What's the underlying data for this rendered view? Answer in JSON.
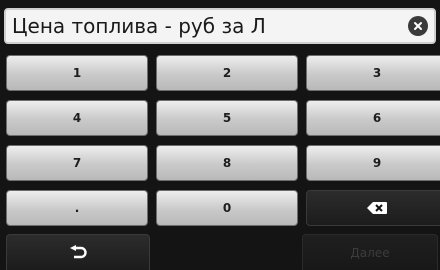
{
  "input": {
    "value": "Цена топлива - руб за Л",
    "clear_icon": "clear-circle-icon"
  },
  "keypad": {
    "keys": [
      {
        "label": "1",
        "name": "key-1"
      },
      {
        "label": "2",
        "name": "key-2"
      },
      {
        "label": "3",
        "name": "key-3"
      },
      {
        "label": "4",
        "name": "key-4"
      },
      {
        "label": "5",
        "name": "key-5"
      },
      {
        "label": "6",
        "name": "key-6"
      },
      {
        "label": "7",
        "name": "key-7"
      },
      {
        "label": "8",
        "name": "key-8"
      },
      {
        "label": "9",
        "name": "key-9"
      },
      {
        "label": ".",
        "name": "key-decimal"
      },
      {
        "label": "0",
        "name": "key-0"
      }
    ],
    "backspace_icon": "backspace-icon"
  },
  "footer": {
    "back_icon": "back-arrow-icon",
    "next_label": "Далее"
  },
  "colors": {
    "key_face": "#d2d2d2",
    "dark_key": "#222222",
    "background": "#141414",
    "field_bg": "#f4f4f4"
  }
}
